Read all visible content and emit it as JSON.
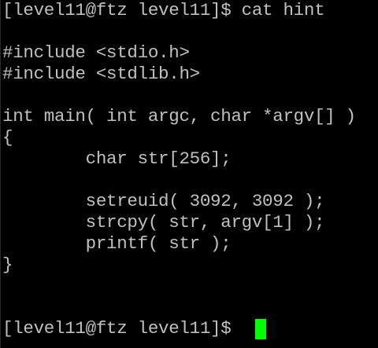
{
  "terminal": {
    "foreground": "#c0c0c0",
    "background": "#000000",
    "cursor_color": "#00ff00",
    "lines": [
      "[level11@ftz level11]$ cat hint",
      "",
      "#include <stdio.h>",
      "#include <stdlib.h>",
      "",
      "int main( int argc, char *argv[] )",
      "{",
      "        char str[256];",
      "",
      "        setreuid( 3092, 3092 );",
      "        strcpy( str, argv[1] );",
      "        printf( str );",
      "}",
      "",
      "",
      "[level11@ftz level11]$ "
    ]
  }
}
